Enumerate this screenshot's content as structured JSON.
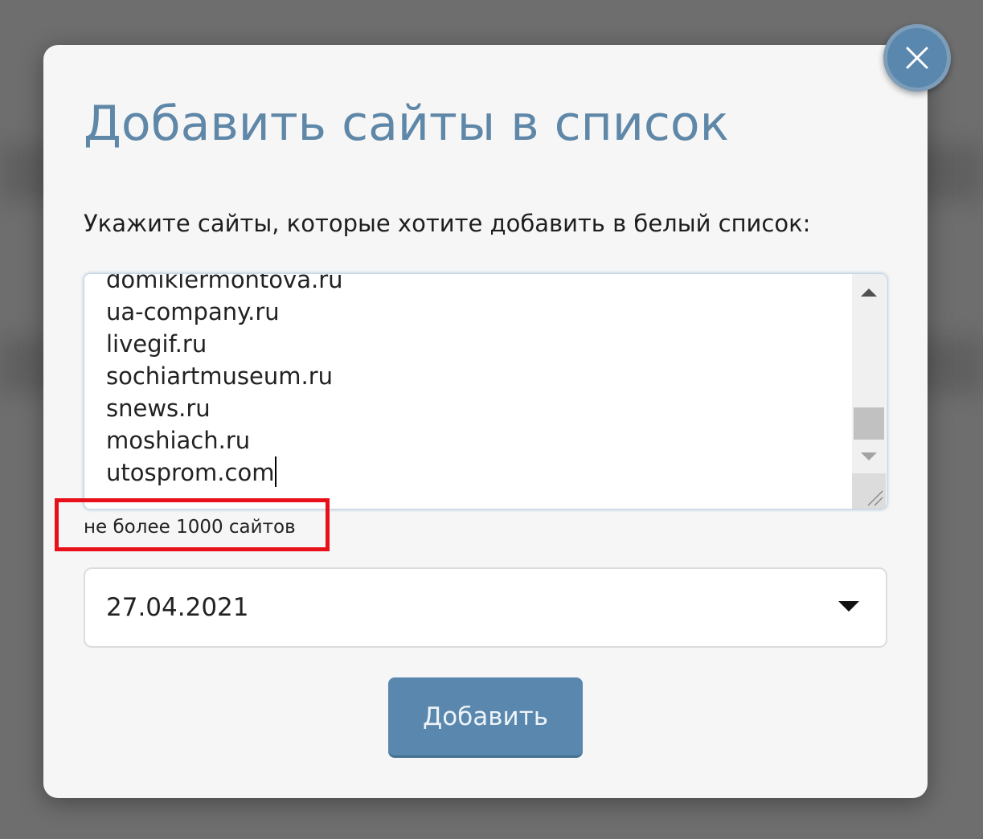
{
  "dialog": {
    "title": "Добавить сайты в список",
    "subtitle": "Укажите сайты, которые хотите добавить в белый список:",
    "sites": [
      "domiklermontova.ru",
      "ua-company.ru",
      "livegif.ru",
      "sochiartmuseum.ru",
      "snews.ru",
      "moshiach.ru",
      "utosprom.com"
    ],
    "limit_hint": "не более 1000 сайтов",
    "date_value": "27.04.2021",
    "submit_label": "Добавить"
  },
  "colors": {
    "accent": "#5a87ad",
    "title": "#5f87a8",
    "highlight": "#e8101a",
    "overlay": "#6e6e6e"
  },
  "icons": {
    "close": "close-icon",
    "dropdown": "caret-down-icon",
    "scroll_up": "arrow-up-icon",
    "scroll_down": "arrow-down-icon",
    "resize": "resize-grip-icon"
  }
}
